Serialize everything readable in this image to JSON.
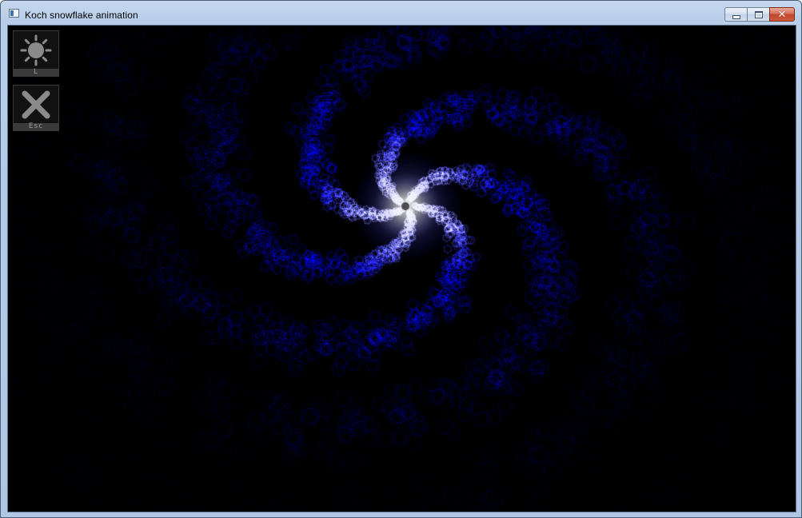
{
  "window": {
    "title": "Koch snowflake animation",
    "icon": "app-window-icon",
    "controls": {
      "minimize_icon": "minimize-icon",
      "maximize_icon": "maximize-icon",
      "close_icon": "close-icon"
    }
  },
  "toolbar": {
    "light_button": {
      "icon": "sun-icon",
      "key": "L"
    },
    "exit_button": {
      "icon": "x-cross-icon",
      "key": "Esc"
    }
  },
  "canvas": {
    "background": "#000000",
    "accent_color": "#2020ff",
    "center_color": "#ffffff"
  }
}
